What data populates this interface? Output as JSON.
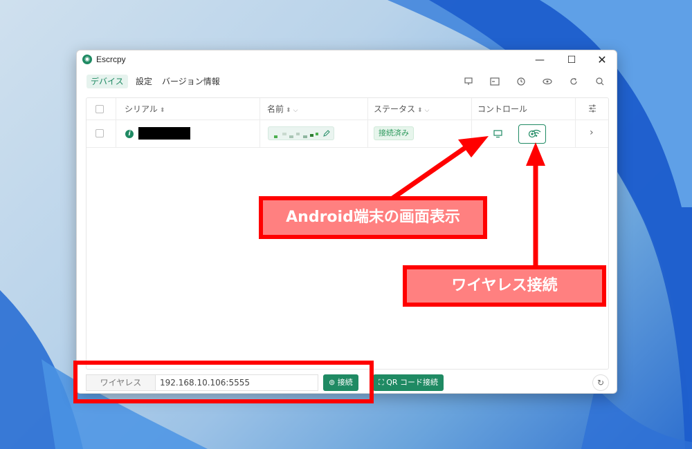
{
  "window": {
    "title": "Escrcpy",
    "minimize": "—",
    "maximize": "☐",
    "close": "✕"
  },
  "menu": {
    "items": [
      {
        "label": "デバイス",
        "active": true
      },
      {
        "label": "設定",
        "active": false
      },
      {
        "label": "バージョン情報",
        "active": false
      }
    ]
  },
  "toolbar_icons": [
    "monitor-icon",
    "terminal-icon",
    "history-icon",
    "eye-icon",
    "refresh-icon",
    "search-icon"
  ],
  "table": {
    "headers": {
      "serial": "シリアル",
      "name": "名前",
      "status": "ステータス",
      "control": "コントロール"
    },
    "rows": [
      {
        "status": "接続済み"
      }
    ]
  },
  "bottom": {
    "wireless_label": "ワイヤレス",
    "address_value": "192.168.10.106:5555",
    "connect_label": "接続",
    "qr_label": "QR コード接続"
  },
  "annotations": {
    "screen_display": "Android端末の画面表示",
    "wireless_connect": "ワイヤレス接続"
  },
  "colors": {
    "accent": "#1f8a63",
    "highlight": "#ff0000",
    "callout_fill": "#ff8080"
  }
}
